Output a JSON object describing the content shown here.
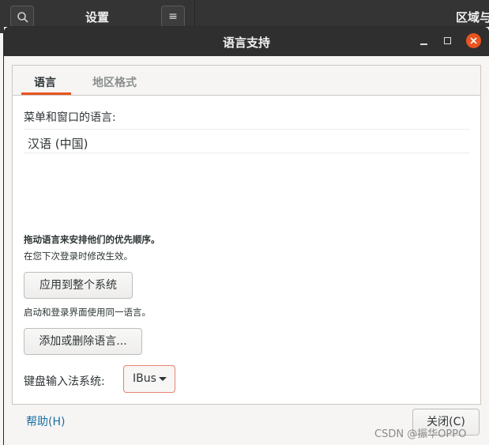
{
  "background_window": {
    "title": "设置",
    "right_title": "区域与",
    "menu_glyph": "≡"
  },
  "dialog": {
    "title": "语言支持",
    "tabs": [
      {
        "label": "语言",
        "active": true
      },
      {
        "label": "地区格式",
        "active": false
      }
    ],
    "menu_window_language_label": "菜单和窗口的语言:",
    "languages": [
      "汉语 (中国)"
    ],
    "drag_hint": "拖动语言来安排他们的优先顺序。",
    "effect_hint": "在您下次登录时修改生效。",
    "apply_button": "应用到整个系统",
    "same_language_hint": "启动和登录界面使用同一语言。",
    "add_remove_button": "添加或删除语言...",
    "keyboard_input_label": "键盘输入法系统:",
    "keyboard_input_value": "IBus",
    "help_link": "帮助(H)",
    "close_button": "关闭(C)"
  },
  "watermark": "CSDN @振华OPPO",
  "colors": {
    "accent": "#e95420",
    "titlebar": "#2f2f2f",
    "link": "#1a6fa5"
  }
}
